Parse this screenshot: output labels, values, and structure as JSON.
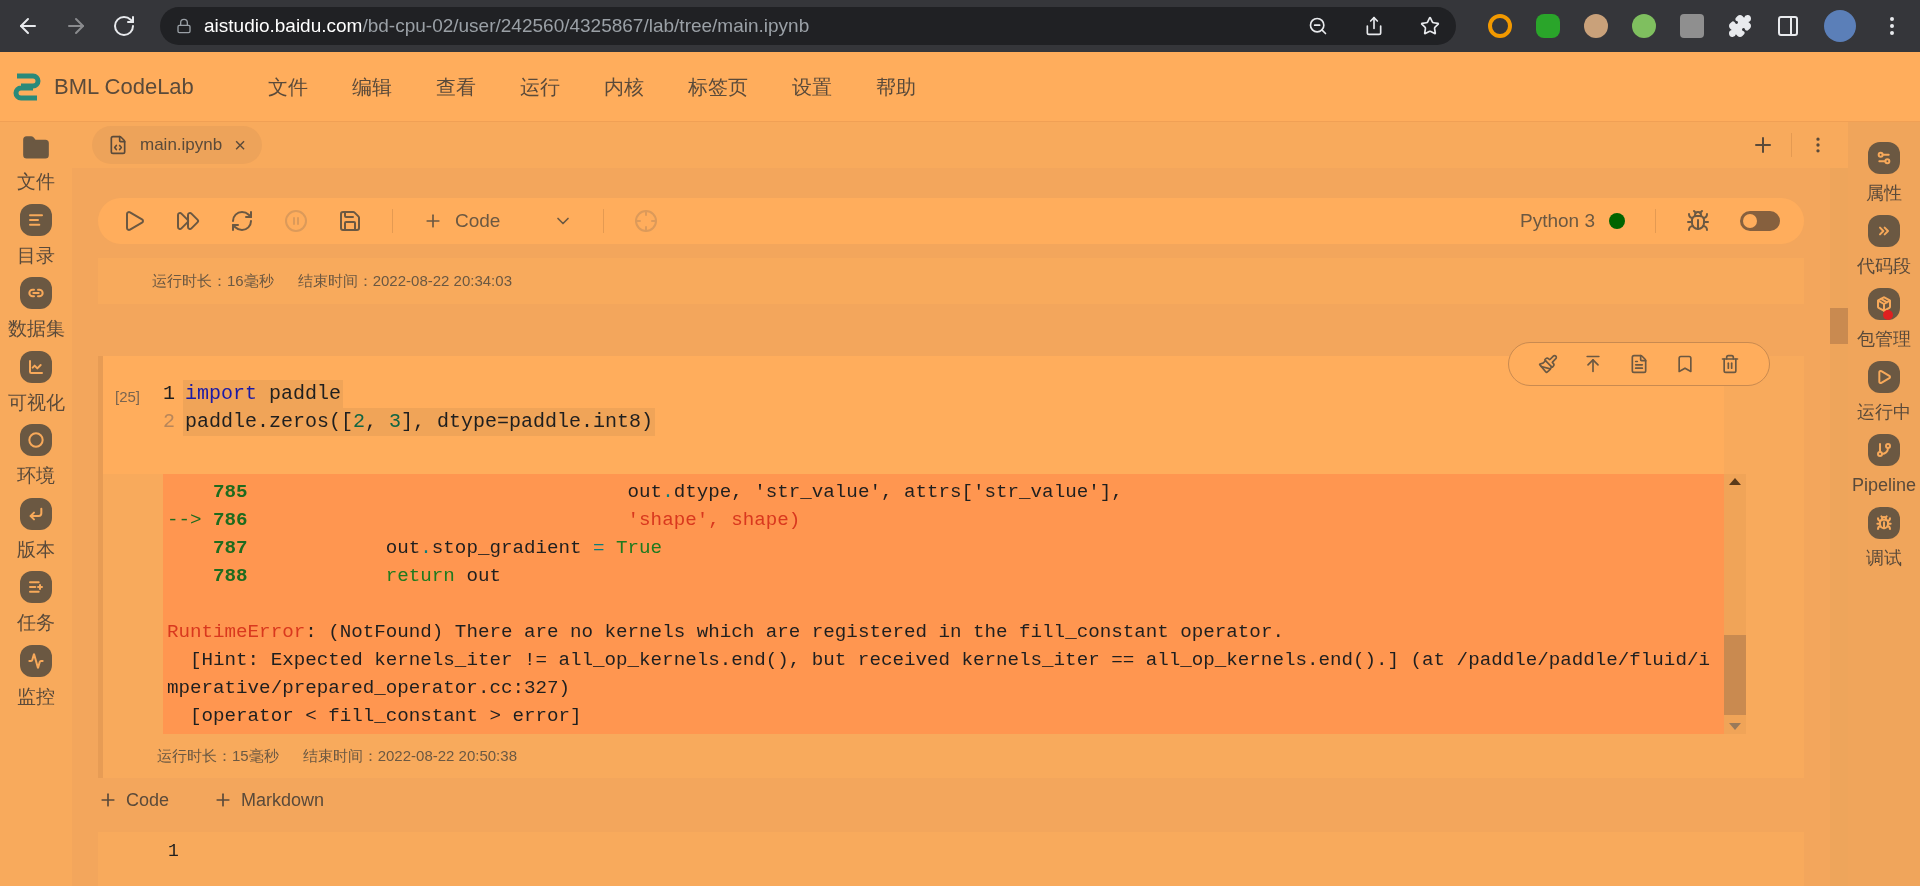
{
  "browser": {
    "url_host": "aistudio.baidu.com",
    "url_path": "/bd-cpu-02/user/242560/4325867/lab/tree/main.ipynb"
  },
  "app": {
    "logo_text": "BML CodeLab",
    "menu": [
      "文件",
      "编辑",
      "查看",
      "运行",
      "内核",
      "标签页",
      "设置",
      "帮助"
    ]
  },
  "left_sidebar": [
    {
      "label": "文件",
      "kind": "folder"
    },
    {
      "label": "目录",
      "kind": "list"
    },
    {
      "label": "数据集",
      "kind": "dataset"
    },
    {
      "label": "可视化",
      "kind": "chart"
    },
    {
      "label": "环境",
      "kind": "ring"
    },
    {
      "label": "版本",
      "kind": "version"
    },
    {
      "label": "任务",
      "kind": "task"
    },
    {
      "label": "监控",
      "kind": "monitor"
    }
  ],
  "right_sidebar": [
    {
      "label": "属性",
      "kind": "gears",
      "notification": false
    },
    {
      "label": "代码段",
      "kind": "snippet",
      "notification": false
    },
    {
      "label": "包管理",
      "kind": "package",
      "notification": true
    },
    {
      "label": "运行中",
      "kind": "running",
      "notification": false
    },
    {
      "label": "Pipeline",
      "kind": "pipeline",
      "notification": false
    },
    {
      "label": "调试",
      "kind": "debug",
      "notification": false
    }
  ],
  "tab": {
    "label": "main.ipynb",
    "close_symbol": "×"
  },
  "toolbar": {
    "cell_type": "Code",
    "kernel": "Python 3",
    "kernel_idle": true,
    "debug_on": false
  },
  "previous_cell": {
    "duration": "运行时长：16毫秒",
    "end_time": "结束时间：2022-08-22 20:34:03"
  },
  "cell": {
    "prompt": "[25]",
    "lines": [
      {
        "number": "1",
        "tokens": [
          {
            "kind": "keyword",
            "text": "import"
          },
          {
            "kind": "code",
            "text": " paddle"
          }
        ]
      },
      {
        "number": "2",
        "tokens": [
          {
            "kind": "code",
            "text": "paddle.zeros(["
          },
          {
            "kind": "number",
            "text": "2"
          },
          {
            "kind": "code",
            "text": ", "
          },
          {
            "kind": "number",
            "text": "3"
          },
          {
            "kind": "code",
            "text": "], dtype=paddle.int8)"
          }
        ]
      }
    ],
    "output": [
      {
        "lines": [
          {
            "tokens": [
              {
                "kind": "lineno",
                "text": "    785"
              },
              {
                "kind": "code",
                "text": "                                 out"
              },
              {
                "kind": "op",
                "text": "."
              },
              {
                "kind": "code",
                "text": "dtype, 'str_value', attrs['str_value'],"
              }
            ]
          },
          {
            "tokens": [
              {
                "kind": "arrow",
                "text": "--> "
              },
              {
                "kind": "lineno",
                "text": "786"
              },
              {
                "kind": "string",
                "text": "                                 'shape', shape)"
              }
            ]
          },
          {
            "tokens": [
              {
                "kind": "lineno",
                "text": "    787"
              },
              {
                "kind": "code",
                "text": "            out"
              },
              {
                "kind": "op",
                "text": "."
              },
              {
                "kind": "code",
                "text": "stop_gradient "
              },
              {
                "kind": "op",
                "text": "="
              },
              {
                "kind": "keyword2",
                "text": " True"
              }
            ]
          },
          {
            "tokens": [
              {
                "kind": "lineno",
                "text": "    788"
              },
              {
                "kind": "keyword2",
                "text": "            return"
              },
              {
                "kind": "code",
                "text": " out"
              }
            ]
          }
        ]
      },
      {
        "lines": [
          {
            "tokens": [
              {
                "kind": "error",
                "text": "RuntimeError"
              },
              {
                "kind": "code",
                "text": ": (NotFound) There are no kernels which are registered in the fill_constant operator."
              }
            ]
          },
          {
            "tokens": [
              {
                "kind": "code",
                "text": "  [Hint: Expected kernels_iter != all_op_kernels.end(), but received kernels_iter == all_op_kernels.end().] (at /paddle/paddle/fluid/imperative/prepared_operator.cc:327)"
              }
            ]
          },
          {
            "tokens": [
              {
                "kind": "code",
                "text": "  [operator < fill_constant > error]"
              }
            ]
          }
        ]
      }
    ],
    "duration": "运行时长：15毫秒",
    "end_time": "结束时间：2022-08-22 20:50:38"
  },
  "add_buttons": [
    "Code",
    "Markdown"
  ],
  "next_cell": {
    "line_number": "1"
  }
}
